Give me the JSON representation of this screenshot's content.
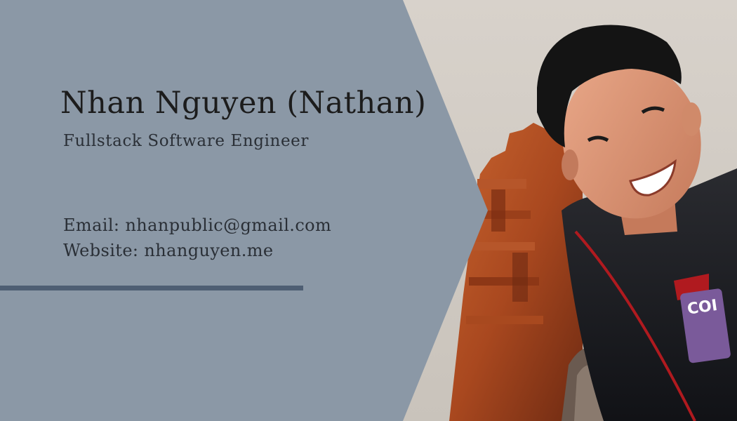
{
  "card": {
    "name": "Nhan Nguyen (Nathan)",
    "title": "Fullstack Software Engineer",
    "email_line": "Email: nhanpublic@gmail.com",
    "website_line": "Website: nhanguyen.me"
  },
  "photo": {
    "jacket_text": "COI"
  },
  "colors": {
    "panel": "#8b98a6",
    "divider": "#4e5e73",
    "text": "#1c1c1c"
  }
}
